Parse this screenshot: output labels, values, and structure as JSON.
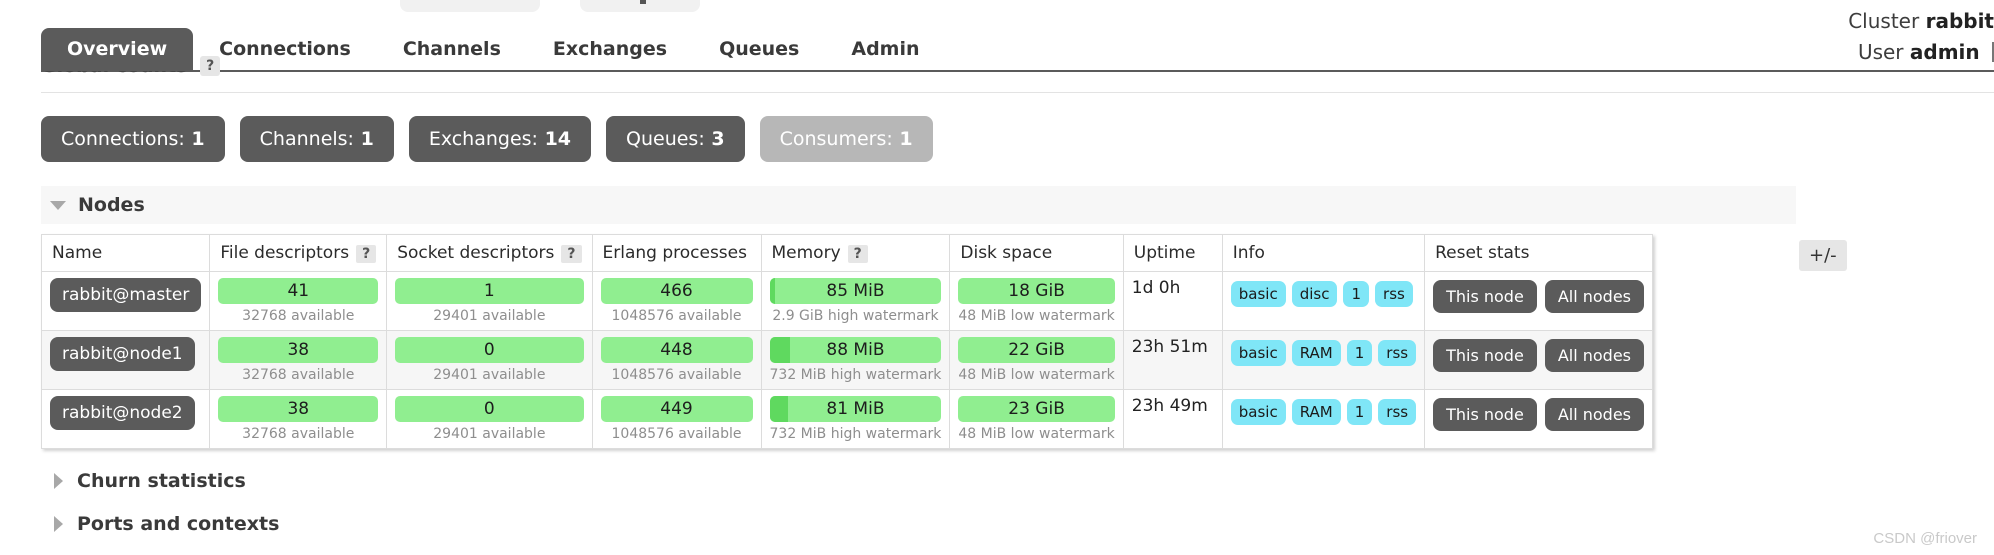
{
  "header": {
    "cluster_label": "Cluster",
    "cluster_name": "rabbit",
    "user_label": "User",
    "user_name": "admin"
  },
  "nav": {
    "tabs": [
      {
        "label": "Overview",
        "active": true
      },
      {
        "label": "Connections",
        "active": false
      },
      {
        "label": "Channels",
        "active": false
      },
      {
        "label": "Exchanges",
        "active": false
      },
      {
        "label": "Queues",
        "active": false
      },
      {
        "label": "Admin",
        "active": false
      }
    ]
  },
  "global_counts": {
    "title": "Global counts",
    "help": "?",
    "counters": [
      {
        "label": "Connections:",
        "value": "1",
        "muted": false
      },
      {
        "label": "Channels:",
        "value": "1",
        "muted": false
      },
      {
        "label": "Exchanges:",
        "value": "14",
        "muted": false
      },
      {
        "label": "Queues:",
        "value": "3",
        "muted": false
      },
      {
        "label": "Consumers:",
        "value": "1",
        "muted": true
      }
    ]
  },
  "nodes_section": {
    "title": "Nodes",
    "plusminus": "+/-",
    "columns": [
      {
        "label": "Name",
        "help": null
      },
      {
        "label": "File descriptors",
        "help": "?"
      },
      {
        "label": "Socket descriptors",
        "help": "?"
      },
      {
        "label": "Erlang processes",
        "help": null
      },
      {
        "label": "Memory",
        "help": "?"
      },
      {
        "label": "Disk space",
        "help": null
      },
      {
        "label": "Uptime",
        "help": null
      },
      {
        "label": "Info",
        "help": null
      },
      {
        "label": "Reset stats",
        "help": null
      }
    ],
    "rows": [
      {
        "name": "rabbit@master",
        "file_descriptors": {
          "value": "41",
          "sub": "32768 available",
          "fill_pct": 0
        },
        "socket_descriptors": {
          "value": "1",
          "sub": "29401 available",
          "fill_pct": 0
        },
        "erlang_processes": {
          "value": "466",
          "sub": "1048576 available",
          "fill_pct": 0
        },
        "memory": {
          "value": "85 MiB",
          "sub": "2.9 GiB high watermark",
          "fill_pct": 3
        },
        "disk_space": {
          "value": "18 GiB",
          "sub": "48 MiB low watermark",
          "fill_pct": 0
        },
        "uptime": "1d 0h",
        "info": [
          "basic",
          "disc",
          "1",
          "rss"
        ],
        "reset": [
          "This node",
          "All nodes"
        ]
      },
      {
        "name": "rabbit@node1",
        "file_descriptors": {
          "value": "38",
          "sub": "32768 available",
          "fill_pct": 0
        },
        "socket_descriptors": {
          "value": "0",
          "sub": "29401 available",
          "fill_pct": 0
        },
        "erlang_processes": {
          "value": "448",
          "sub": "1048576 available",
          "fill_pct": 0
        },
        "memory": {
          "value": "88 MiB",
          "sub": "732 MiB high watermark",
          "fill_pct": 12
        },
        "disk_space": {
          "value": "22 GiB",
          "sub": "48 MiB low watermark",
          "fill_pct": 0
        },
        "uptime": "23h 51m",
        "info": [
          "basic",
          "RAM",
          "1",
          "rss"
        ],
        "reset": [
          "This node",
          "All nodes"
        ]
      },
      {
        "name": "rabbit@node2",
        "file_descriptors": {
          "value": "38",
          "sub": "32768 available",
          "fill_pct": 0
        },
        "socket_descriptors": {
          "value": "0",
          "sub": "29401 available",
          "fill_pct": 0
        },
        "erlang_processes": {
          "value": "449",
          "sub": "1048576 available",
          "fill_pct": 0
        },
        "memory": {
          "value": "81 MiB",
          "sub": "732 MiB high watermark",
          "fill_pct": 11
        },
        "disk_space": {
          "value": "23 GiB",
          "sub": "48 MiB low watermark",
          "fill_pct": 0
        },
        "uptime": "23h 49m",
        "info": [
          "basic",
          "RAM",
          "1",
          "rss"
        ],
        "reset": [
          "This node",
          "All nodes"
        ]
      }
    ]
  },
  "collapsed_sections": [
    {
      "title": "Churn statistics"
    },
    {
      "title": "Ports and contexts"
    }
  ],
  "watermark": "CSDN @friover",
  "colors": {
    "dark_chip": "#5b5b5b",
    "muted_chip": "#b7b7b7",
    "bar_bg": "#90ee90",
    "bar_fill": "#5fd95f",
    "badge": "#7fe6f7",
    "section_bg": "#f7f7f7"
  }
}
